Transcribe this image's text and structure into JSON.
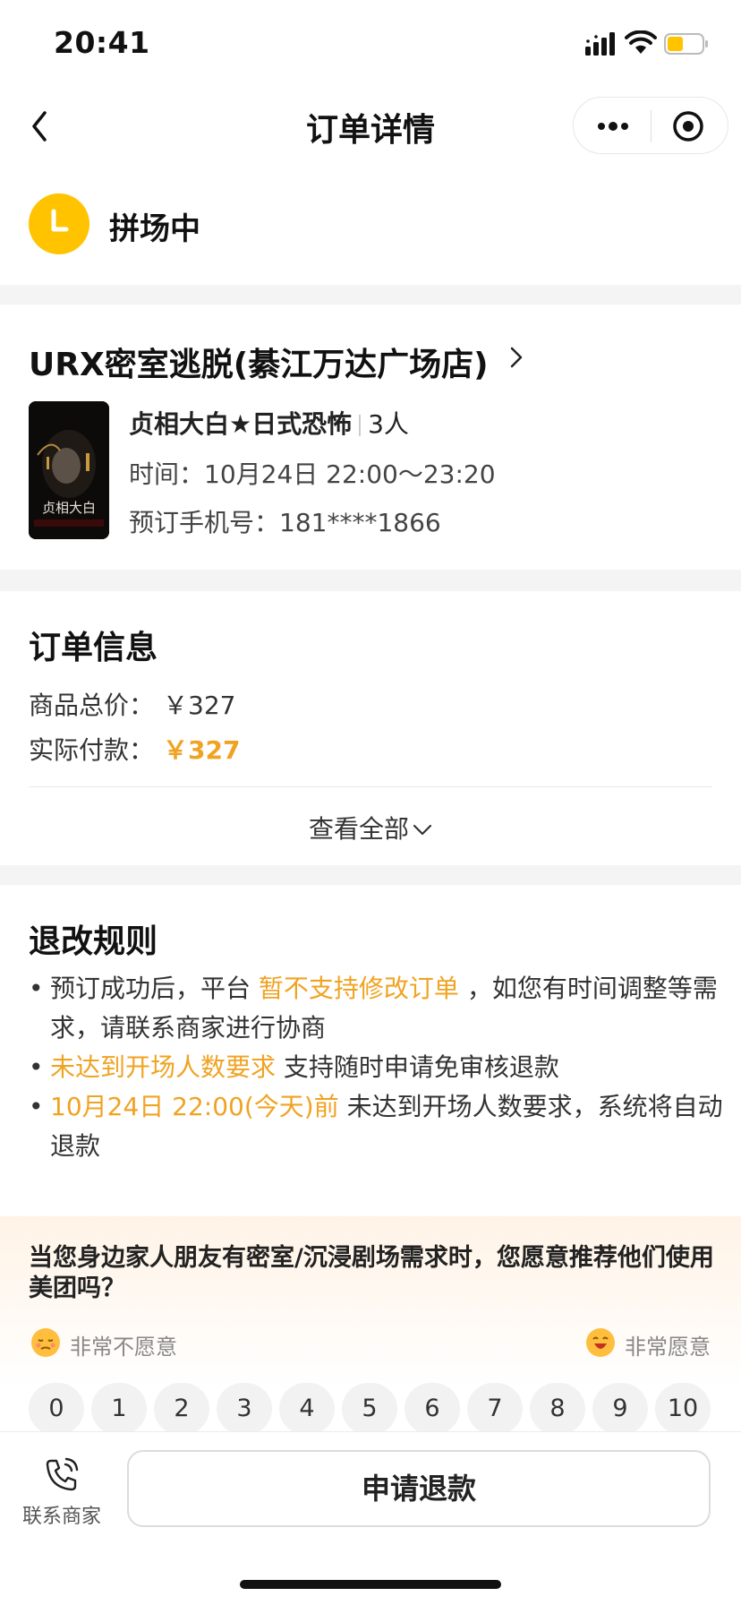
{
  "status_bar": {
    "time": "20:41",
    "battery_color": "#ffc300"
  },
  "nav": {
    "title": "订单详情",
    "back_icon": "chevron-left-icon",
    "more_icon": "more-dots-icon",
    "capsule_icon": "target-icon"
  },
  "order_status": {
    "text": "拼场中",
    "icon": "clock-icon",
    "color": "#ffc300"
  },
  "store": {
    "name": "URX密室逃脱(綦江万达广场店)",
    "product": "贞相大白★日式恐怖",
    "people": "3人",
    "time_label": "时间：",
    "time_value": "10月24日 22:00～23:20",
    "phone_label": "预订手机号：",
    "phone_value": "181****1866",
    "poster_title": "贞相大白"
  },
  "order_info": {
    "title": "订单信息",
    "total_label": "商品总价：",
    "total_value": "￥327",
    "paid_label": "实际付款：",
    "paid_value": "￥327",
    "view_all": "查看全部"
  },
  "refund_rules": {
    "title": "退改规则",
    "rule1_a": "预订成功后，平台",
    "rule1_b": "暂不支持修改订单",
    "rule1_c": "，如您有时间调整等需求，请联系商家进行协商",
    "rule2_a": "未达到开场人数要求",
    "rule2_b": "支持随时申请免审核退款",
    "rule3_a": "10月24日 22:00(今天)前",
    "rule3_b": "未达到开场人数要求，系统将自动退款"
  },
  "survey": {
    "question": "当您身边家人朋友有密室/沉浸剧场需求时，您愿意推荐他们使用美团吗？",
    "low_label": "非常不愿意",
    "high_label": "非常愿意",
    "scores": [
      "0",
      "1",
      "2",
      "3",
      "4",
      "5",
      "6",
      "7",
      "8",
      "9",
      "10"
    ]
  },
  "bottom": {
    "contact_label": "联系商家",
    "contact_icon": "phone-icon",
    "refund_button": "申请退款"
  },
  "colors": {
    "accent": "#f0a322",
    "brand_yellow": "#ffc300"
  }
}
